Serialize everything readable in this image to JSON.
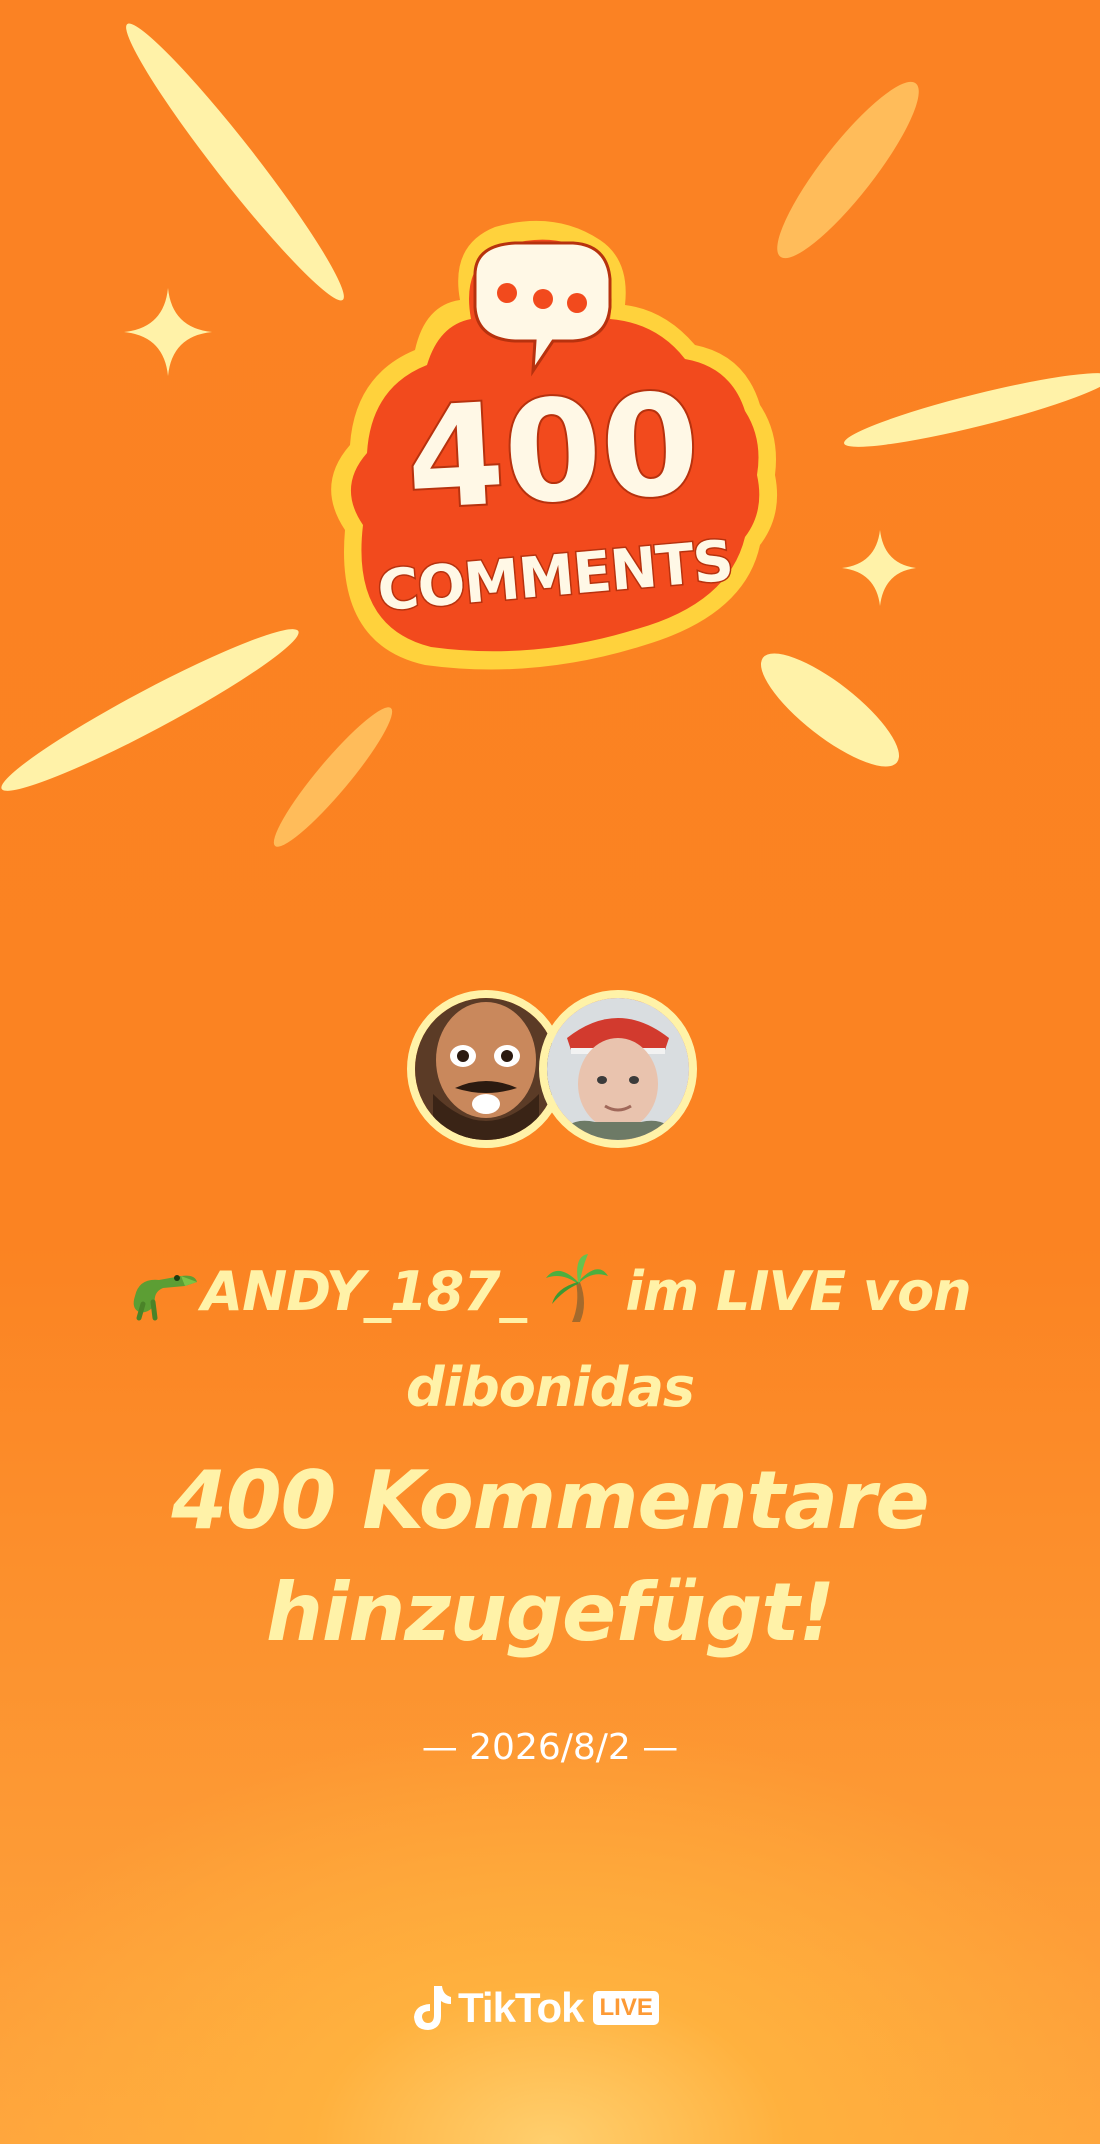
{
  "milestone": {
    "badge_number": "400",
    "badge_word": "COMMENTS",
    "badge_icon": "speech-bubble-icon"
  },
  "participants": {
    "user_avatar_icon": "bearded-man-avatar",
    "host_avatar_icon": "red-cap-avatar"
  },
  "headline": {
    "prefix_emoji": "🐊",
    "username": "ANDY_187_",
    "suffix_emoji": "🌴",
    "connector": "im LIVE von",
    "host": "dibonidas"
  },
  "achievement": {
    "line1": "400 Kommentare",
    "line2": "hinzugefügt!"
  },
  "date": {
    "text": "— 2026/8/2 —"
  },
  "brand": {
    "logo_icon": "tiktok-note-icon",
    "name": "TikTok",
    "badge": "LIVE"
  },
  "colors": {
    "background": "#fb8223",
    "accent_yellow": "#fff2a8",
    "badge_red": "#f24a1d",
    "badge_border": "#ffd23c",
    "white": "#ffffff"
  }
}
